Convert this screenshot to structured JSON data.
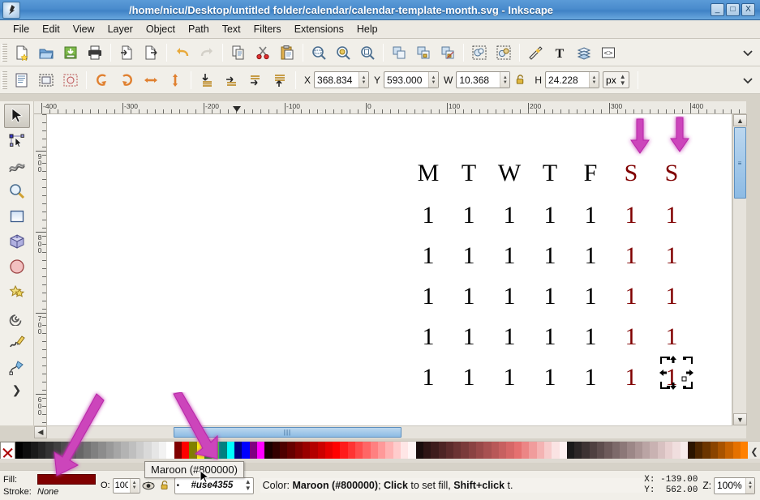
{
  "window": {
    "title": "/home/nicu/Desktop/untitled folder/calendar/calendar-template-month.svg - Inkscape",
    "logo_icon": "inkscape-logo-icon",
    "minimize_label": "_",
    "maximize_label": "□",
    "close_label": "X"
  },
  "menu": {
    "items": [
      {
        "label": "File"
      },
      {
        "label": "Edit"
      },
      {
        "label": "View"
      },
      {
        "label": "Layer"
      },
      {
        "label": "Object"
      },
      {
        "label": "Path"
      },
      {
        "label": "Text"
      },
      {
        "label": "Filters"
      },
      {
        "label": "Extensions"
      },
      {
        "label": "Help"
      }
    ]
  },
  "command_toolbar": {
    "buttons": [
      {
        "name": "new-document-button",
        "icon": "new-document-icon"
      },
      {
        "name": "open-document-button",
        "icon": "open-folder-icon"
      },
      {
        "name": "save-document-button",
        "icon": "save-disk-icon"
      },
      {
        "name": "print-document-button",
        "icon": "printer-icon"
      },
      {
        "name": "import-button",
        "icon": "import-icon"
      },
      {
        "name": "export-button",
        "icon": "export-icon"
      },
      {
        "name": "undo-button",
        "icon": "undo-arrow-icon"
      },
      {
        "name": "redo-button",
        "icon": "redo-arrow-icon"
      },
      {
        "name": "copy-button",
        "icon": "copy-icon"
      },
      {
        "name": "cut-button",
        "icon": "scissors-icon"
      },
      {
        "name": "paste-button",
        "icon": "clipboard-icon"
      },
      {
        "name": "zoom-selection-button",
        "icon": "zoom-selection-icon"
      },
      {
        "name": "zoom-drawing-button",
        "icon": "zoom-drawing-icon"
      },
      {
        "name": "zoom-page-button",
        "icon": "zoom-page-icon"
      },
      {
        "name": "duplicate-button",
        "icon": "duplicate-icon"
      },
      {
        "name": "clone-button",
        "icon": "clone-icon"
      },
      {
        "name": "unlink-clone-button",
        "icon": "unlink-clone-icon"
      },
      {
        "name": "group-button",
        "icon": "group-icon"
      },
      {
        "name": "ungroup-button",
        "icon": "ungroup-icon"
      },
      {
        "name": "fill-stroke-button",
        "icon": "fill-stroke-icon"
      },
      {
        "name": "text-properties-button",
        "icon": "text-T-icon"
      },
      {
        "name": "layers-button",
        "icon": "layers-stack-icon"
      },
      {
        "name": "xml-editor-button",
        "icon": "xml-editor-icon"
      },
      {
        "name": "toolbar-overflow-button",
        "icon": "chevron-down-icon"
      }
    ]
  },
  "tool_toolbar": {
    "buttons": [
      {
        "name": "select-all-button",
        "icon": "select-all-icon"
      },
      {
        "name": "select-all-layers-button",
        "icon": "select-all-layers-icon"
      },
      {
        "name": "deselect-button",
        "icon": "deselect-icon"
      },
      {
        "name": "rotate-ccw-button",
        "icon": "rotate-ccw-icon"
      },
      {
        "name": "rotate-cw-button",
        "icon": "rotate-cw-icon"
      },
      {
        "name": "flip-horizontal-button",
        "icon": "flip-horizontal-icon"
      },
      {
        "name": "flip-vertical-button",
        "icon": "flip-vertical-icon"
      },
      {
        "name": "lower-to-bottom-button",
        "icon": "lower-to-bottom-icon"
      },
      {
        "name": "lower-button",
        "icon": "lower-icon"
      },
      {
        "name": "raise-button",
        "icon": "raise-icon"
      },
      {
        "name": "raise-to-top-button",
        "icon": "raise-to-top-icon"
      }
    ],
    "fields": {
      "x_label": "X",
      "x_value": "368.834",
      "y_label": "Y",
      "y_value": "593.000",
      "w_label": "W",
      "w_value": "10.368",
      "h_label": "H",
      "h_value": "24.228",
      "lock_icon": "lock-open-icon",
      "unit": "px"
    },
    "overflow_icon": "chevron-down-icon"
  },
  "toolbox": {
    "tools": [
      {
        "name": "selector-tool",
        "icon": "arrow-cursor-icon",
        "active": true
      },
      {
        "name": "node-editor-tool",
        "icon": "node-editor-icon",
        "active": false
      },
      {
        "name": "tweak-tool",
        "icon": "tweak-wave-icon",
        "active": false
      },
      {
        "name": "zoom-tool",
        "icon": "magnifier-icon",
        "active": false
      },
      {
        "name": "rectangle-tool",
        "icon": "rectangle-icon",
        "active": false
      },
      {
        "name": "box3d-tool",
        "icon": "cube-3d-icon",
        "active": false
      },
      {
        "name": "ellipse-tool",
        "icon": "ellipse-icon",
        "active": false
      },
      {
        "name": "star-tool",
        "icon": "star-icon",
        "active": false
      },
      {
        "name": "spiral-tool",
        "icon": "spiral-icon",
        "active": false
      },
      {
        "name": "pencil-tool",
        "icon": "pencil-icon",
        "active": false
      },
      {
        "name": "bezier-tool",
        "icon": "bezier-pen-icon",
        "active": false
      }
    ],
    "more_icon": "chevron-right-icon"
  },
  "rulers": {
    "horizontal_labels": [
      "-400",
      "-300",
      "-200",
      "-100",
      "0",
      "100",
      "200",
      "300",
      "400"
    ],
    "vertical_labels": [
      "900",
      "800",
      "700",
      "600"
    ],
    "unit": "px"
  },
  "canvas": {
    "calendar": {
      "header": [
        {
          "text": "M",
          "color": "#000000"
        },
        {
          "text": "T",
          "color": "#000000"
        },
        {
          "text": "W",
          "color": "#000000"
        },
        {
          "text": "T",
          "color": "#000000"
        },
        {
          "text": "F",
          "color": "#000000"
        },
        {
          "text": "S",
          "color": "#800000"
        },
        {
          "text": "S",
          "color": "#800000"
        }
      ],
      "rows": [
        [
          {
            "text": "1",
            "color": "#000000"
          },
          {
            "text": "1",
            "color": "#000000"
          },
          {
            "text": "1",
            "color": "#000000"
          },
          {
            "text": "1",
            "color": "#000000"
          },
          {
            "text": "1",
            "color": "#000000"
          },
          {
            "text": "1",
            "color": "#800000"
          },
          {
            "text": "1",
            "color": "#800000"
          }
        ],
        [
          {
            "text": "1",
            "color": "#000000"
          },
          {
            "text": "1",
            "color": "#000000"
          },
          {
            "text": "1",
            "color": "#000000"
          },
          {
            "text": "1",
            "color": "#000000"
          },
          {
            "text": "1",
            "color": "#000000"
          },
          {
            "text": "1",
            "color": "#800000"
          },
          {
            "text": "1",
            "color": "#800000"
          }
        ],
        [
          {
            "text": "1",
            "color": "#000000"
          },
          {
            "text": "1",
            "color": "#000000"
          },
          {
            "text": "1",
            "color": "#000000"
          },
          {
            "text": "1",
            "color": "#000000"
          },
          {
            "text": "1",
            "color": "#000000"
          },
          {
            "text": "1",
            "color": "#800000"
          },
          {
            "text": "1",
            "color": "#800000"
          }
        ],
        [
          {
            "text": "1",
            "color": "#000000"
          },
          {
            "text": "1",
            "color": "#000000"
          },
          {
            "text": "1",
            "color": "#000000"
          },
          {
            "text": "1",
            "color": "#000000"
          },
          {
            "text": "1",
            "color": "#000000"
          },
          {
            "text": "1",
            "color": "#800000"
          },
          {
            "text": "1",
            "color": "#800000"
          }
        ],
        [
          {
            "text": "1",
            "color": "#000000"
          },
          {
            "text": "1",
            "color": "#000000"
          },
          {
            "text": "1",
            "color": "#000000"
          },
          {
            "text": "1",
            "color": "#000000"
          },
          {
            "text": "1",
            "color": "#000000"
          },
          {
            "text": "1",
            "color": "#800000"
          },
          {
            "text": "1",
            "color": "#800000"
          }
        ]
      ]
    },
    "annotations": {
      "arrow_color": "#cc44bb",
      "arrows": [
        {
          "name": "annotation-arrow-saturday-column",
          "direction": "down"
        },
        {
          "name": "annotation-arrow-sunday-column",
          "direction": "down"
        },
        {
          "name": "annotation-arrow-fill-swatch",
          "direction": "down-left"
        },
        {
          "name": "annotation-arrow-palette-maroon",
          "direction": "down-right"
        }
      ]
    },
    "selection": {
      "name": "selection-handles",
      "icon": "move-arrows-icon"
    }
  },
  "scrollbars": {
    "h_left_icon": "chevron-left-icon",
    "h_thumb_grip": "|||",
    "v_up_icon": "chevron-up-icon",
    "v_down_icon": "chevron-down-icon",
    "v_thumb_grip": "≡"
  },
  "palette": {
    "none_label": "X",
    "hover_tooltip": "Maroon (#800000)",
    "scroll_right_icon": "chevron-left-icon",
    "swatches": [
      "#000000",
      "#0d0d0d",
      "#1a1a1a",
      "#262626",
      "#333333",
      "#404040",
      "#4d4d4d",
      "#595959",
      "#666666",
      "#737373",
      "#808080",
      "#8c8c8c",
      "#999999",
      "#a6a6a6",
      "#b3b3b3",
      "#bfbfbf",
      "#cccccc",
      "#d9d9d9",
      "#e6e6e6",
      "#f2f2f2",
      "#ffffff",
      "#800000",
      "#ff0000",
      "#808000",
      "#ffff00",
      "#008000",
      "#00ff00",
      "#008080",
      "#00ffff",
      "#000080",
      "#0000ff",
      "#800080",
      "#ff00ff",
      "#1a0000",
      "#330000",
      "#4d0000",
      "#660000",
      "#800000",
      "#990000",
      "#b30000",
      "#cc0000",
      "#e60000",
      "#ff0000",
      "#ff1a1a",
      "#ff3333",
      "#ff4d4d",
      "#ff6666",
      "#ff8080",
      "#ff9999",
      "#ffb3b3",
      "#ffcccc",
      "#ffe6e6",
      "#fff5f5",
      "#1a0d0d",
      "#2e1515",
      "#3d1c1c",
      "#4d2424",
      "#5c2b2b",
      "#6b3333",
      "#7a3a3a",
      "#8a4242",
      "#994949",
      "#a85151",
      "#b85858",
      "#c76060",
      "#d66767",
      "#e57070",
      "#ec8585",
      "#f09c9c",
      "#f4b3b3",
      "#f7cccc",
      "#fae3e3",
      "#fdf2f2",
      "#1a1a1a",
      "#2b2626",
      "#3d3333",
      "#4f4040",
      "#5e4d4d",
      "#6e5b5b",
      "#7d6a6a",
      "#8c7878",
      "#9c8787",
      "#ab9595",
      "#baa4a4",
      "#c9b2b2",
      "#d8c1c1",
      "#e7d0d0",
      "#f0dede",
      "#f7ecec",
      "#2b1500",
      "#4d2600",
      "#6b3500",
      "#8a4400",
      "#a85300",
      "#c76200",
      "#e57100",
      "#ff8000"
    ]
  },
  "statusbar": {
    "fill_label": "Fill:",
    "fill_color": "#800000",
    "stroke_label": "Stroke:",
    "stroke_value": "None",
    "opacity_label": "O:",
    "opacity_value": "100",
    "layer_visibility_icon": "eye-icon",
    "layer_lock_icon": "lock-icon",
    "layer_name": "#use4355",
    "status_prefix": "Color: ",
    "status_color_name": "Maroon (#800000)",
    "status_middle": "; ",
    "status_click": "Click",
    "status_after_click": " to set fill, ",
    "status_shiftclick": "Shift+click",
    "status_tail": " t.",
    "cursor_x_label": "X:",
    "cursor_x_value": "-139.00",
    "cursor_y_label": "Y:",
    "cursor_y_value": " 562.00",
    "zoom_label": "Z:",
    "zoom_value": "100%"
  }
}
